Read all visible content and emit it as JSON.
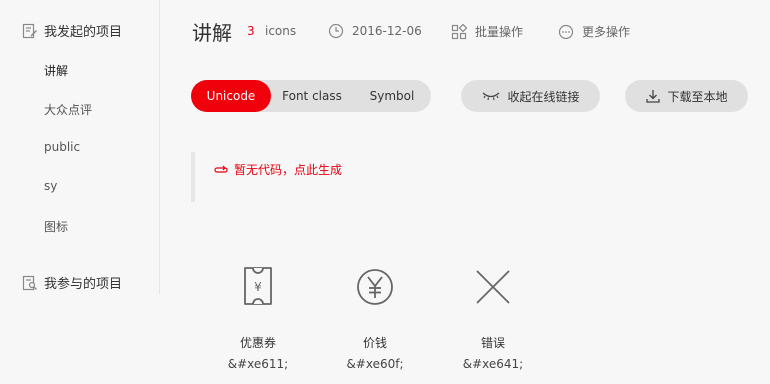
{
  "sidebar": {
    "my_projects_label": "我发起的项目",
    "items": [
      {
        "label": "讲解"
      },
      {
        "label": "大众点评"
      },
      {
        "label": "public"
      },
      {
        "label": "sy"
      },
      {
        "label": "图标"
      }
    ],
    "joined_projects_label": "我参与的项目"
  },
  "header": {
    "title": "讲解",
    "icon_count": "3",
    "icon_count_label": "icons",
    "date": "2016-12-06",
    "batch_label": "批量操作",
    "more_label": "更多操作"
  },
  "tabs": [
    {
      "label": "Unicode",
      "active": true
    },
    {
      "label": "Font class",
      "active": false
    },
    {
      "label": "Symbol",
      "active": false
    }
  ],
  "actions": {
    "collapse_label": "收起在线链接",
    "download_label": "下载至本地"
  },
  "code_panel": {
    "empty_text": "暂无代码，点此生成"
  },
  "icons": [
    {
      "name": "优惠券",
      "code": "&#xe611;",
      "glyph": "coupon-icon"
    },
    {
      "name": "价钱",
      "code": "&#xe60f;",
      "glyph": "yen-icon"
    },
    {
      "name": "错误",
      "code": "&#xe641;",
      "glyph": "close-icon"
    }
  ],
  "colors": {
    "accent": "#f0000a",
    "text": "#333333",
    "pill_bg": "#e0e0e0",
    "background": "#f7f7f7"
  }
}
